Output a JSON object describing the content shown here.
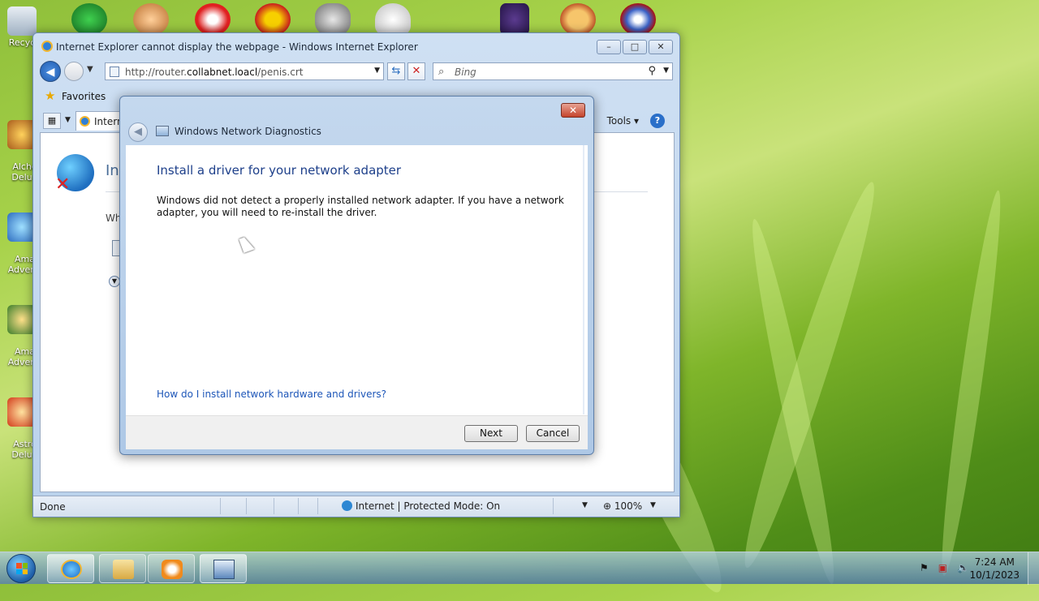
{
  "ie": {
    "title": "Internet Explorer cannot display the webpage - Windows Internet Explorer",
    "address_host_prefix": "http://router.",
    "address_domain": "collabnet.loacl",
    "address_path": "/penis.crt",
    "search_placeholder": "Bing",
    "favorites_label": "Favorites",
    "tab_label": "Intern",
    "tools_label": "Tools",
    "content_title": "Int",
    "content_text": "Wh",
    "status_text": "Done",
    "zone_text": "Internet | Protected Mode: On",
    "zoom_text": "100%"
  },
  "dialog": {
    "title": "Windows Network Diagnostics",
    "heading": "Install a driver for your network adapter",
    "message": "Windows did not detect a properly installed network adapter. If you have a network adapter, you will need to re-install the driver.",
    "help_link": "How do I install network hardware and drivers?",
    "next_label": "Next",
    "cancel_label": "Cancel"
  },
  "desktop_icons": [
    {
      "label": "Recyc"
    },
    {
      "label": "Alche\nDelu"
    },
    {
      "label": "Ama\nAdven"
    },
    {
      "label": "Ama\nAdven"
    },
    {
      "label": "Astro\nDelu"
    }
  ],
  "taskbar": {
    "time": "7:24 AM",
    "date": "10/1/2023"
  },
  "colors": {
    "dialog_heading": "#1d3f8a",
    "link": "#1d56b8",
    "close_button": "#c4432b"
  }
}
